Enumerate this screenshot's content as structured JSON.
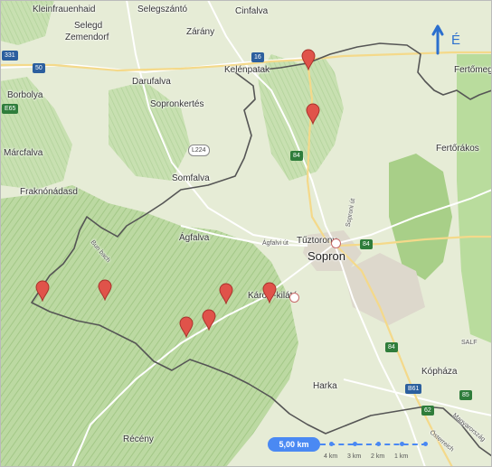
{
  "places": {
    "kleinfrauenhaid": "Kleinfrauenhaid",
    "selegszanto": "Selegszántó",
    "cinfalva": "Cinfalva",
    "selegd": "Selegd",
    "zemendorf": "Zemendorf",
    "zarany": "Zárány",
    "kelenpatak": "Kelénpatak",
    "fertomeggy": "Fertőmeggy",
    "borbolya": "Borbolya",
    "darufalva": "Darufalva",
    "sopronkeresztur": "Sopronkertés",
    "marcfalva": "Márcfalva",
    "fertorakos": "Fertőrákos",
    "somfalva": "Somfalva",
    "fraknonadasd": "Fraknónádasd",
    "agfalva": "Ágfalva",
    "tuztorony": "Tűztorony",
    "sopron": "Sopron",
    "karolykilato": "Károly-kilátó",
    "harka": "Harka",
    "kophaza": "Kópháza",
    "recseny": "Récény",
    "agfalvi_ut": "Ágfalvi út",
    "bunbach": "Bun bach",
    "osterreich": "Österreich",
    "magyarorszag": "Magyarország",
    "salf": "SALF",
    "sopron_street": "Soproni út"
  },
  "roads": {
    "r16": "16",
    "r84a": "84",
    "r84b": "84",
    "r84c": "84",
    "r50": "50",
    "r331": "331",
    "l224": "L224",
    "e65": "E65",
    "b61": "B61",
    "a62": "62",
    "m85": "85"
  },
  "compass": {
    "letter": "É"
  },
  "scale": {
    "pill": "5,00 km",
    "ticks": [
      "4 km",
      "3 km",
      "2 km",
      "1 km"
    ]
  },
  "colors": {
    "border": "#5a5a5a",
    "marker": "#e0534a",
    "forest": "#a8cf88",
    "accent": "#4a89f3"
  },
  "markers": [
    {
      "name": "marker-north-1"
    },
    {
      "name": "marker-north-2"
    },
    {
      "name": "marker-west-1"
    },
    {
      "name": "marker-west-2"
    },
    {
      "name": "marker-center-1"
    },
    {
      "name": "marker-center-2"
    },
    {
      "name": "marker-center-3"
    },
    {
      "name": "marker-karoly"
    }
  ]
}
